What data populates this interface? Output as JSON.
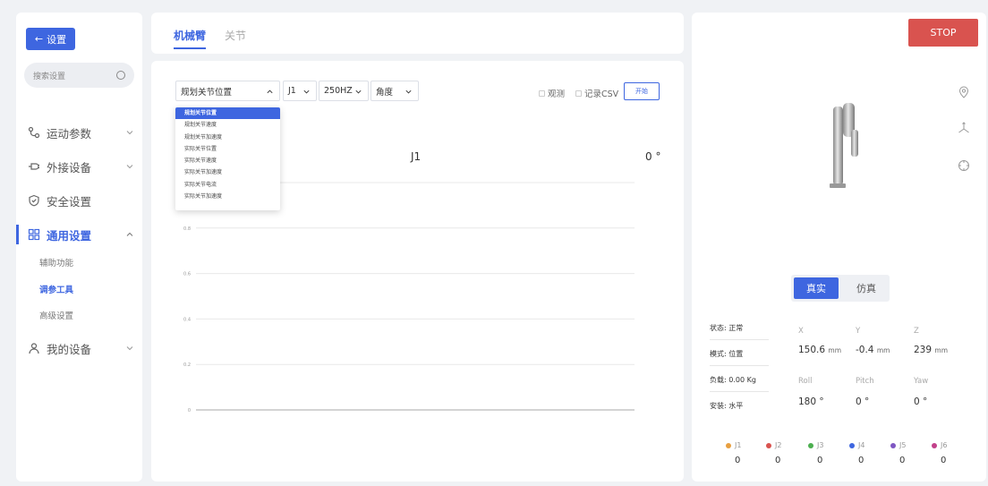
{
  "sidebar": {
    "back_label": "设置",
    "search_placeholder": "搜索设置",
    "items": [
      {
        "label": "运动参数"
      },
      {
        "label": "外接设备"
      },
      {
        "label": "安全设置"
      },
      {
        "label": "通用设置"
      },
      {
        "label": "我的设备"
      }
    ],
    "sub_items": [
      {
        "label": "辅助功能"
      },
      {
        "label": "调参工具"
      },
      {
        "label": "高级设置"
      }
    ]
  },
  "tabs": [
    {
      "label": "机械臂"
    },
    {
      "label": "关节"
    }
  ],
  "toolbar": {
    "type_select": "规划关节位置",
    "joint_select": "J1",
    "freq_select": "250HZ",
    "unit_select": "角度",
    "observe_label": "观测",
    "record_label": "记录CSV",
    "start_label": "开始"
  },
  "dropdown_options": [
    "规划关节位置",
    "规划关节速度",
    "规划关节加速度",
    "实际关节位置",
    "实际关节速度",
    "实际关节加速度",
    "实际关节电流",
    "实际关节加速度"
  ],
  "chart_data": {
    "type": "line",
    "title": "J1",
    "current_value": "0 °",
    "yticks": [
      "1",
      "0.8",
      "0.6",
      "0.4",
      "0.2",
      "0"
    ],
    "ylim": [
      0,
      1
    ],
    "series": [
      {
        "values": [
          0,
          0
        ]
      }
    ],
    "grid": true
  },
  "right": {
    "stop_label": "STOP",
    "mode_real": "真实",
    "mode_sim": "仿真",
    "status": [
      "状态: 正常",
      "模式: 位置",
      "负载: 0.00 Kg",
      "安装: 水平"
    ],
    "coords": [
      {
        "label": "X",
        "value": "150.6",
        "unit": "mm"
      },
      {
        "label": "Y",
        "value": "-0.4",
        "unit": "mm"
      },
      {
        "label": "Z",
        "value": "239",
        "unit": "mm"
      },
      {
        "label": "Roll",
        "value": "180 °",
        "unit": ""
      },
      {
        "label": "Pitch",
        "value": "0 °",
        "unit": ""
      },
      {
        "label": "Yaw",
        "value": "0 °",
        "unit": ""
      }
    ],
    "joints": [
      {
        "label": "J1",
        "value": "0",
        "color": "#e8a040"
      },
      {
        "label": "J2",
        "value": "0",
        "color": "#d9534f"
      },
      {
        "label": "J3",
        "value": "0",
        "color": "#4caf50"
      },
      {
        "label": "J4",
        "value": "0",
        "color": "#3e66e0"
      },
      {
        "label": "J5",
        "value": "0",
        "color": "#7e57c2"
      },
      {
        "label": "J6",
        "value": "0",
        "color": "#c2408a"
      }
    ]
  }
}
